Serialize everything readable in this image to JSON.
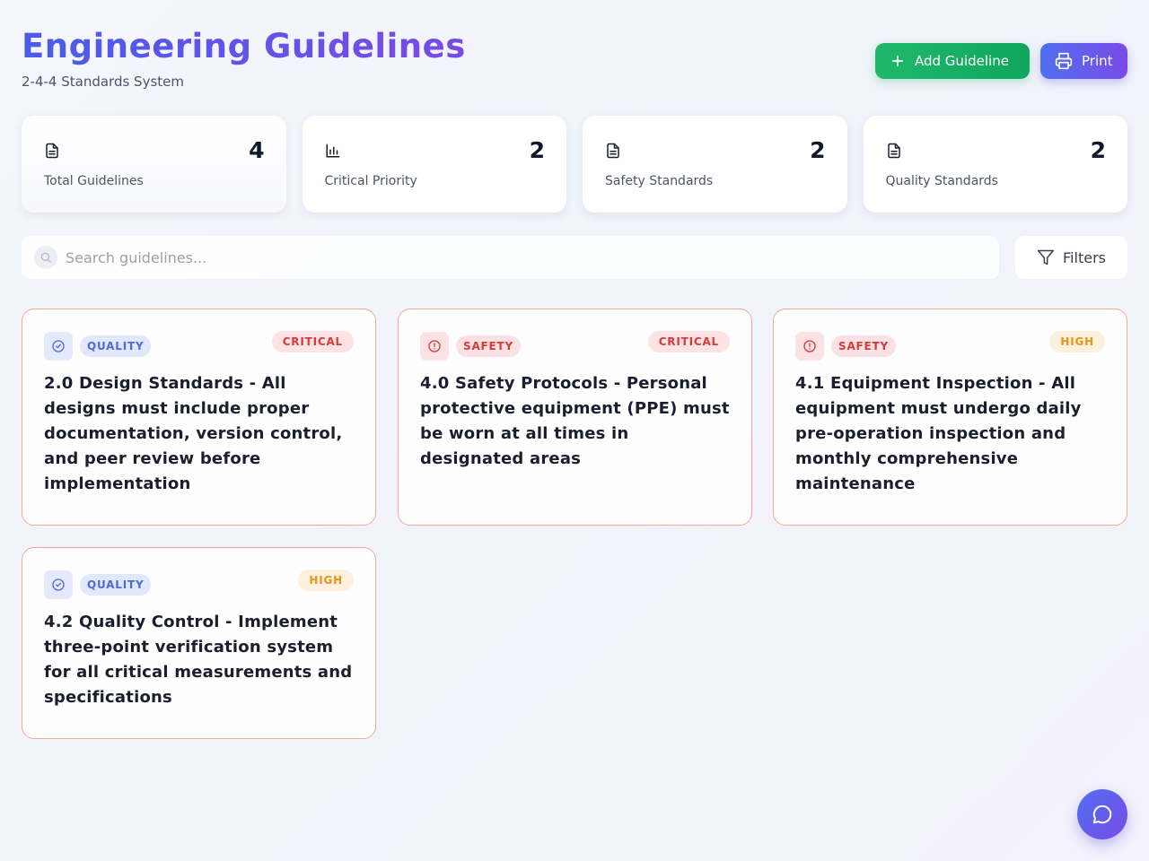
{
  "header": {
    "title": "Engineering Guidelines",
    "subtitle": "2-4-4 Standards System"
  },
  "actions": {
    "add_label": "Add Guideline",
    "print_label": "Print"
  },
  "stats": [
    {
      "icon": "document-icon",
      "value": "4",
      "label": "Total Guidelines"
    },
    {
      "icon": "bar-chart-icon",
      "value": "2",
      "label": "Critical Priority"
    },
    {
      "icon": "document-icon",
      "value": "2",
      "label": "Safety Standards"
    },
    {
      "icon": "document-icon",
      "value": "2",
      "label": "Quality Standards"
    }
  ],
  "search": {
    "placeholder": "Search guidelines...",
    "value": ""
  },
  "filters": {
    "label": "Filters"
  },
  "guidelines": [
    {
      "category": "QUALITY",
      "category_icon": "check-circle-icon",
      "priority": "CRITICAL",
      "text": "2.0 Design Standards - All designs must include proper documentation, version control, and peer review before implementation"
    },
    {
      "category": "SAFETY",
      "category_icon": "alert-circle-icon",
      "priority": "CRITICAL",
      "text": "4.0 Safety Protocols - Personal protective equipment (PPE) must be worn at all times in designated areas"
    },
    {
      "category": "SAFETY",
      "category_icon": "alert-circle-icon",
      "priority": "HIGH",
      "text": "4.1 Equipment Inspection - All equipment must undergo daily pre-operation inspection and monthly comprehensive maintenance"
    },
    {
      "category": "QUALITY",
      "category_icon": "check-circle-icon",
      "priority": "HIGH",
      "text": "4.2 Quality Control - Implement three-point verification system for all critical measurements and specifications"
    }
  ],
  "colors": {
    "accent_blue": "#4a5de8",
    "accent_purple": "#7a4ae8",
    "success_green": "#1fb86a",
    "critical_red": "#d63b3b",
    "high_orange": "#e5951a"
  },
  "chat": {
    "icon": "chat-bubble-icon"
  }
}
